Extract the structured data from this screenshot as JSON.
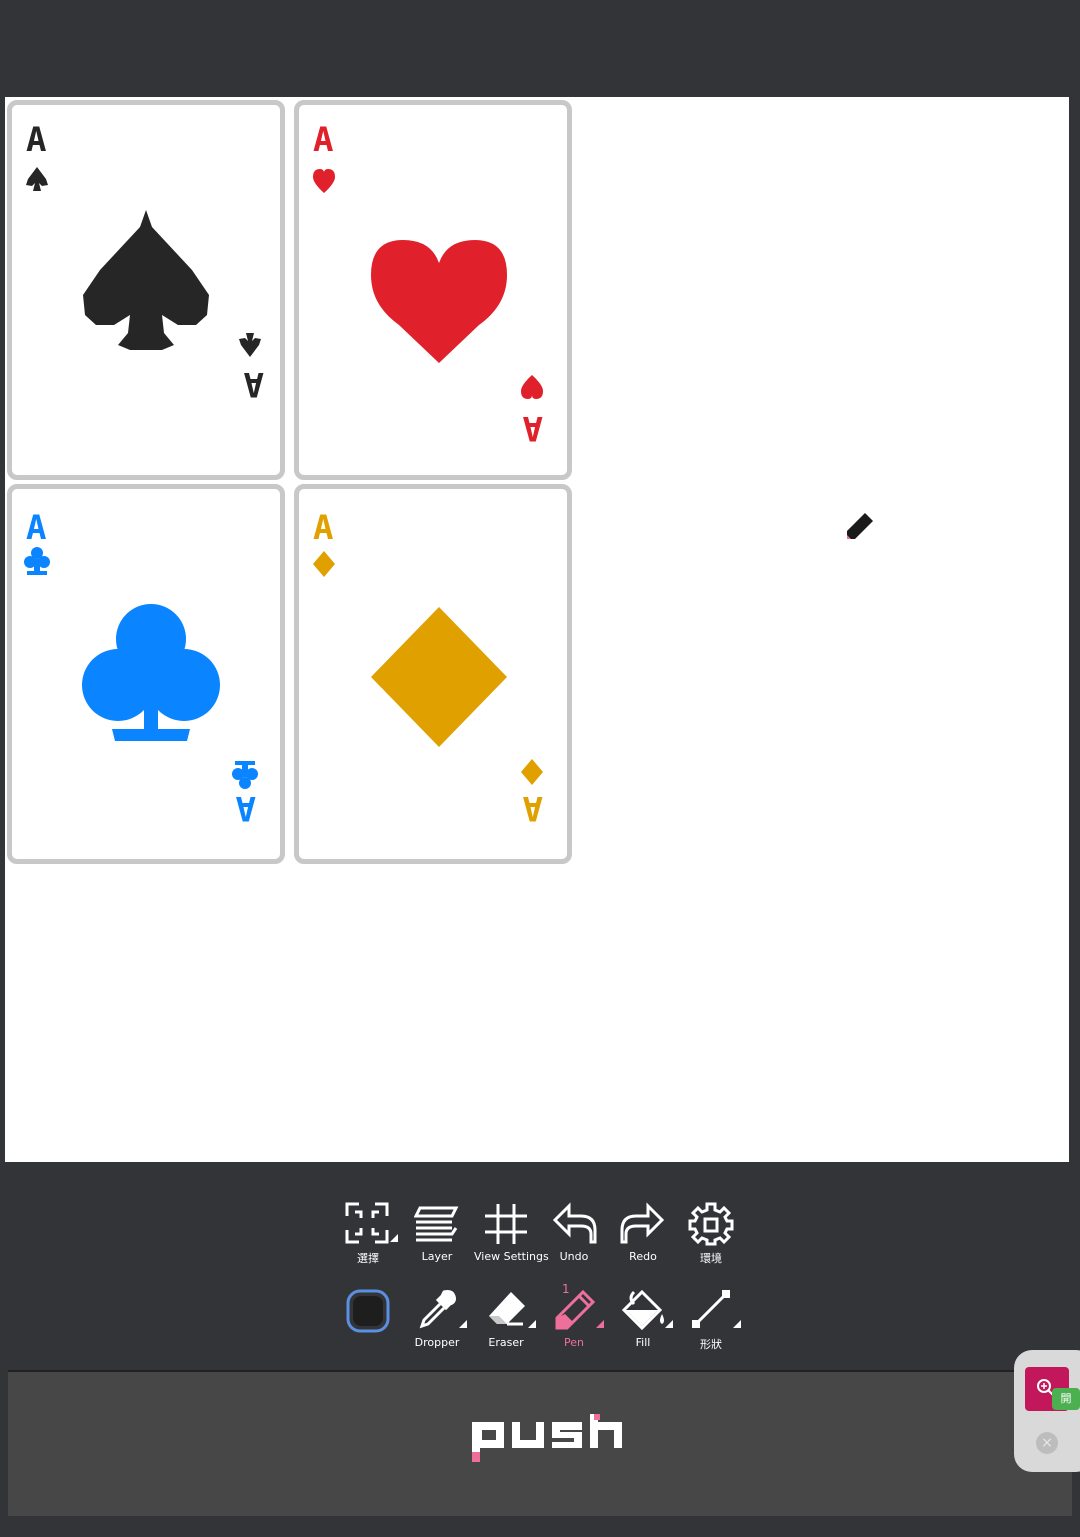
{
  "canvas": {
    "cards": [
      {
        "rank": "A",
        "suit": "spade",
        "color": "#262626"
      },
      {
        "rank": "A",
        "suit": "heart",
        "color": "#e0202a"
      },
      {
        "rank": "A",
        "suit": "club",
        "color": "#0a84ff"
      },
      {
        "rank": "A",
        "suit": "diamond",
        "color": "#e0a000"
      }
    ]
  },
  "toolbar": {
    "row1": [
      {
        "name": "select",
        "label": "選擇",
        "icon": "select-icon"
      },
      {
        "name": "layer",
        "label": "Layer",
        "icon": "layer-icon"
      },
      {
        "name": "view-settings",
        "label": "View Settings",
        "icon": "grid-icon"
      },
      {
        "name": "undo",
        "label": "Undo",
        "icon": "undo-icon"
      },
      {
        "name": "redo",
        "label": "Redo",
        "icon": "redo-icon"
      },
      {
        "name": "environment",
        "label": "環境",
        "icon": "gear-icon"
      }
    ],
    "row2": [
      {
        "name": "color",
        "label": "",
        "icon": "color-swatch-icon"
      },
      {
        "name": "dropper",
        "label": "Dropper",
        "icon": "dropper-icon"
      },
      {
        "name": "eraser",
        "label": "Eraser",
        "icon": "eraser-icon"
      },
      {
        "name": "pen",
        "label": "Pen",
        "icon": "pen-icon",
        "size": "1",
        "active": true
      },
      {
        "name": "fill",
        "label": "Fill",
        "icon": "fill-icon"
      },
      {
        "name": "shape",
        "label": "形狀",
        "icon": "line-icon"
      }
    ],
    "current_color": "#1e1e1e",
    "accent_color": "#ee6f9a"
  },
  "push_panel": {
    "logo": "push"
  },
  "side_widget": {
    "open_badge": "開",
    "close_label": "×"
  }
}
